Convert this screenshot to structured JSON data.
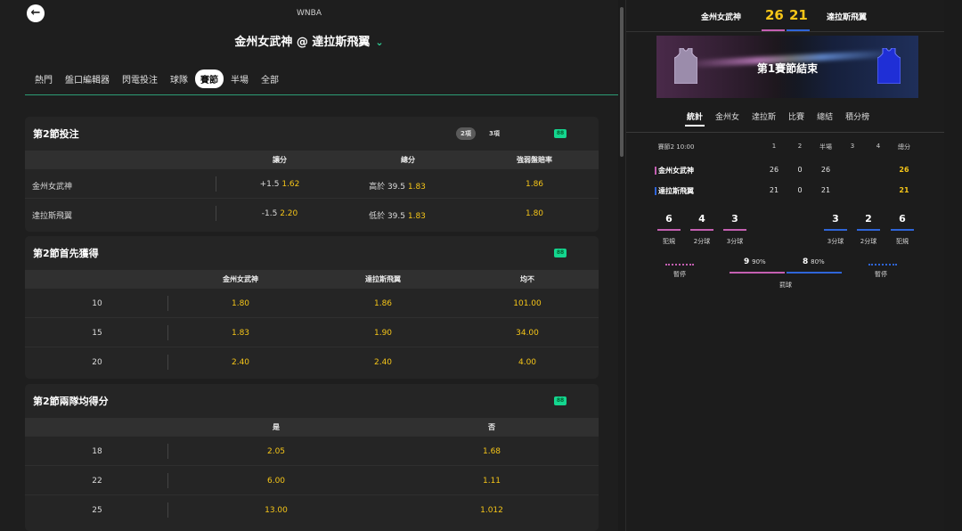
{
  "header": {
    "league": "WNBA",
    "match_title": "金州女武神 @ 達拉斯飛翼",
    "tabs": [
      "熱門",
      "盤口編輯器",
      "閃電投注",
      "球隊",
      "賽節",
      "半場",
      "全部"
    ],
    "active_tab": "賽節"
  },
  "card1": {
    "title": "第2節投注",
    "pills": [
      "2項",
      "3項"
    ],
    "columns": [
      "讓分",
      "總分",
      "強弱盤賠率"
    ],
    "rows": [
      {
        "team": "金州女武神",
        "spread_line": "+1.5",
        "spread_odds": "1.62",
        "total_line": "高於 39.5",
        "total_odds": "1.83",
        "ml": "1.86"
      },
      {
        "team": "達拉斯飛翼",
        "spread_line": "-1.5",
        "spread_odds": "2.20",
        "total_line": "低於 39.5",
        "total_odds": "1.83",
        "ml": "1.80"
      }
    ]
  },
  "card2": {
    "title": "第2節首先獲得",
    "columns": [
      "金州女武神",
      "達拉斯飛翼",
      "均不"
    ],
    "rows": [
      {
        "pts": "10",
        "a": "1.80",
        "b": "1.86",
        "none": "101.00"
      },
      {
        "pts": "15",
        "a": "1.83",
        "b": "1.90",
        "none": "34.00"
      },
      {
        "pts": "20",
        "a": "2.40",
        "b": "2.40",
        "none": "4.00"
      }
    ]
  },
  "card3": {
    "title": "第2節兩隊均得分",
    "columns": [
      "是",
      "否"
    ],
    "rows": [
      {
        "pts": "18",
        "yes": "2.05",
        "no": "1.68"
      },
      {
        "pts": "22",
        "yes": "6.00",
        "no": "1.11"
      },
      {
        "pts": "25",
        "yes": "13.00",
        "no": "1.012"
      }
    ]
  },
  "scoreboard": {
    "team_a": "金州女武神",
    "team_b": "達拉斯飛翼",
    "score_a": "26",
    "score_b": "21",
    "banner_title": "第1賽節結束",
    "tabs": [
      "統計",
      "金州女",
      "達拉斯",
      "比賽",
      "總結",
      "積分榜"
    ],
    "quarter_header": {
      "label": "賽節2 10:00",
      "cols": [
        "1",
        "2",
        "半場",
        "3",
        "4",
        "總分"
      ]
    },
    "rows": [
      {
        "team": "金州女武神",
        "q1": "26",
        "q2": "0",
        "half": "26",
        "total": "26"
      },
      {
        "team": "達拉斯飛翼",
        "q1": "21",
        "q2": "0",
        "half": "21",
        "total": "21"
      }
    ],
    "stats_a": [
      {
        "val": "6",
        "label": "犯規"
      },
      {
        "val": "4",
        "label": "2分球"
      },
      {
        "val": "3",
        "label": "3分球"
      }
    ],
    "stats_b": [
      {
        "val": "3",
        "label": "3分球"
      },
      {
        "val": "2",
        "label": "2分球"
      },
      {
        "val": "6",
        "label": "犯規"
      }
    ],
    "timeout_label": "暫停",
    "ft_a": {
      "val": "9",
      "pct": "90%"
    },
    "ft_b": {
      "val": "8",
      "pct": "80%"
    },
    "ft_label": "罰球",
    "colors": {
      "team_a": "#c45fb1",
      "team_b": "#2f65d8",
      "accent": "#14d68f",
      "odds": "#f5c518"
    }
  }
}
